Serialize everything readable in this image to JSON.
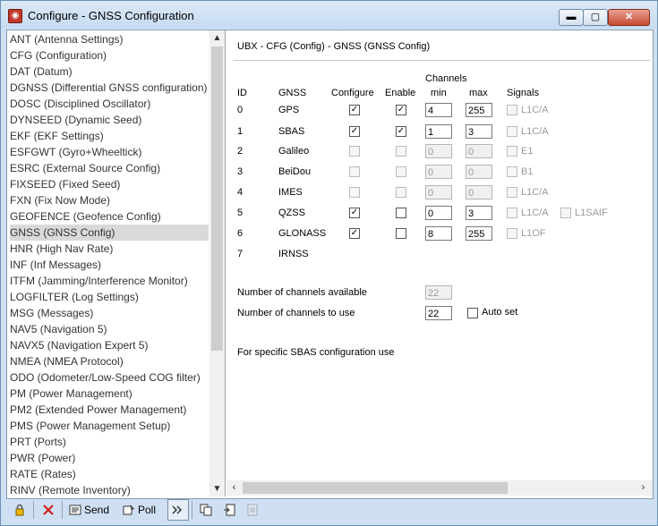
{
  "window": {
    "title": "Configure - GNSS Configuration",
    "controls": {
      "minimize": "▬",
      "maximize": "▢",
      "close": "✕"
    }
  },
  "sidebar": {
    "items": [
      "ANT (Antenna Settings)",
      "CFG (Configuration)",
      "DAT (Datum)",
      "DGNSS (Differential GNSS configuration)",
      "DOSC (Disciplined Oscillator)",
      "DYNSEED (Dynamic Seed)",
      "EKF (EKF Settings)",
      "ESFGWT (Gyro+Wheeltick)",
      "ESRC (External Source Config)",
      "FIXSEED (Fixed Seed)",
      "FXN (Fix Now Mode)",
      "GEOFENCE (Geofence Config)",
      "GNSS (GNSS Config)",
      "HNR (High Nav Rate)",
      "INF (Inf Messages)",
      "ITFM (Jamming/Interference Monitor)",
      "LOGFILTER (Log Settings)",
      "MSG (Messages)",
      "NAV5 (Navigation 5)",
      "NAVX5 (Navigation Expert 5)",
      "NMEA (NMEA Protocol)",
      "ODO (Odometer/Low-Speed COG filter)",
      "PM (Power Management)",
      "PM2 (Extended Power Management)",
      "PMS (Power Management Setup)",
      "PRT (Ports)",
      "PWR (Power)",
      "RATE (Rates)",
      "RINV (Remote Inventory)"
    ],
    "selected": "GNSS (GNSS Config)"
  },
  "panel": {
    "header": "UBX - CFG (Config) - GNSS (GNSS Config)",
    "columns": {
      "channels": "Channels",
      "id": "ID",
      "gnss": "GNSS",
      "configure": "Configure",
      "enable": "Enable",
      "min": "min",
      "max": "max",
      "signals": "Signals"
    },
    "rows": [
      {
        "id": "0",
        "gnss": "GPS",
        "configure": true,
        "enable": true,
        "min": "4",
        "max": "255",
        "signals": [
          "L1C/A"
        ],
        "enabled": true
      },
      {
        "id": "1",
        "gnss": "SBAS",
        "configure": true,
        "enable": true,
        "min": "1",
        "max": "3",
        "signals": [
          "L1C/A"
        ],
        "enabled": true
      },
      {
        "id": "2",
        "gnss": "Galileo",
        "configure": false,
        "enable": false,
        "min": "0",
        "max": "0",
        "signals": [
          "E1"
        ],
        "enabled": false
      },
      {
        "id": "3",
        "gnss": "BeiDou",
        "configure": false,
        "enable": false,
        "min": "0",
        "max": "0",
        "signals": [
          "B1"
        ],
        "enabled": false
      },
      {
        "id": "4",
        "gnss": "IMES",
        "configure": false,
        "enable": false,
        "min": "0",
        "max": "0",
        "signals": [
          "L1C/A"
        ],
        "enabled": false
      },
      {
        "id": "5",
        "gnss": "QZSS",
        "configure": true,
        "enable": false,
        "min": "0",
        "max": "3",
        "signals": [
          "L1C/A",
          "L1SAIF"
        ],
        "enabled": true
      },
      {
        "id": "6",
        "gnss": "GLONASS",
        "configure": true,
        "enable": false,
        "min": "8",
        "max": "255",
        "signals": [
          "L1OF"
        ],
        "enabled": true
      },
      {
        "id": "7",
        "gnss": "IRNSS"
      }
    ],
    "channels_available_label": "Number of channels available",
    "channels_available": "22",
    "channels_to_use_label": "Number of channels to use",
    "channels_to_use": "22",
    "auto_set_label": "Auto set",
    "sbas_note": "For specific SBAS configuration use"
  },
  "toolbar": {
    "send_label": "Send",
    "poll_label": "Poll"
  }
}
